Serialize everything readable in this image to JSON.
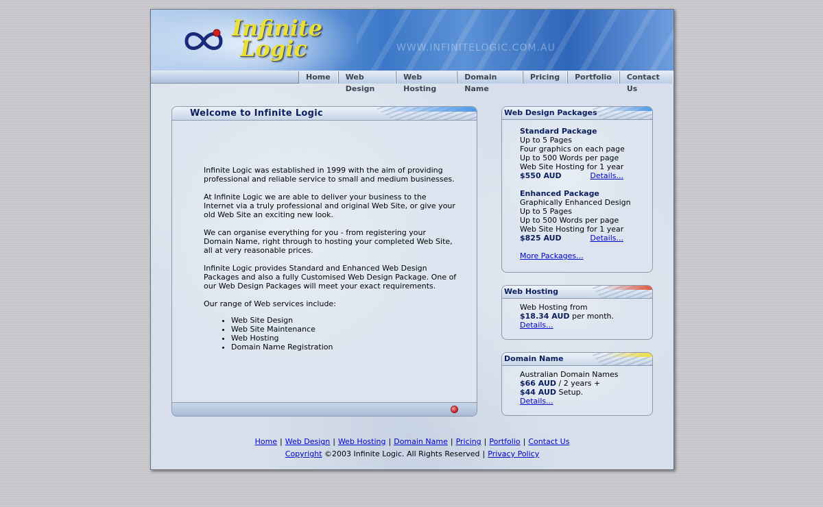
{
  "header": {
    "logo_line1": "Infinite",
    "logo_line2": "Logic",
    "url_watermark": "WWW.INFINITELOGIC.COM.AU"
  },
  "nav": [
    "Home",
    "Web Design",
    "Web Hosting",
    "Domain Name",
    "Pricing",
    "Portfolio",
    "Contact Us"
  ],
  "welcome": {
    "title": "Welcome to Infinite Logic",
    "paragraphs": [
      "Infinite Logic was established in 1999 with the aim of providing professional and reliable service to small and medium businesses.",
      "At Infinite Logic we are able to deliver your business to the Internet via a truly professional and original Web Site, or give your old Web Site an exciting new look.",
      "We can organise everything for you - from registering your Domain Name, right through to hosting your completed Web Site, all at very reasonable prices.",
      "Infinite Logic provides Standard and Enhanced Web Design Packages and also a fully Customised Web Design Package. One of our Web Design Packages will meet your exact requirements.",
      "Our range of Web services include:"
    ],
    "services": [
      "Web Site Design",
      "Web Site Maintenance",
      "Web Hosting",
      "Domain Name Registration"
    ]
  },
  "design_packages": {
    "title": "Web Design Packages",
    "standard": {
      "name": "Standard Package",
      "features": [
        "Up to 5 Pages",
        "Four graphics on each page",
        "Up to 500 Words per page",
        "Web Site Hosting for 1 year"
      ],
      "price": "$550 AUD",
      "details": "Details..."
    },
    "enhanced": {
      "name": "Enhanced Package",
      "features": [
        "Graphically Enhanced Design",
        "Up to 5 Pages",
        "Up to 500 Words per page",
        "Web Site Hosting for 1 year"
      ],
      "price": "$825 AUD",
      "details": "Details..."
    },
    "more": "More Packages..."
  },
  "hosting": {
    "title": "Web Hosting",
    "line1": "Web Hosting from",
    "price": "$18.34 AUD",
    "suffix": "per month.",
    "details": "Details..."
  },
  "domain": {
    "title": "Domain Name",
    "line1": "Australian Domain Names",
    "price1": "$66 AUD",
    "mid": "/ 2 years +",
    "price2": "$44 AUD",
    "suffix": "Setup.",
    "details": "Details..."
  },
  "footer": {
    "links": [
      "Home",
      "Web Design",
      "Web Hosting",
      "Domain Name",
      "Pricing",
      "Portfolio",
      "Contact Us"
    ],
    "copyright_link": "Copyright",
    "copyright_text": "©2003 Infinite Logic. All Rights Reserved",
    "privacy": "Privacy Policy"
  },
  "colors": {
    "heading": "#0b1f5f",
    "link": "#0000cc",
    "hosting_accent": "#e0553c",
    "domain_accent": "#f0dc3c",
    "design_accent": "#4d98e8"
  }
}
